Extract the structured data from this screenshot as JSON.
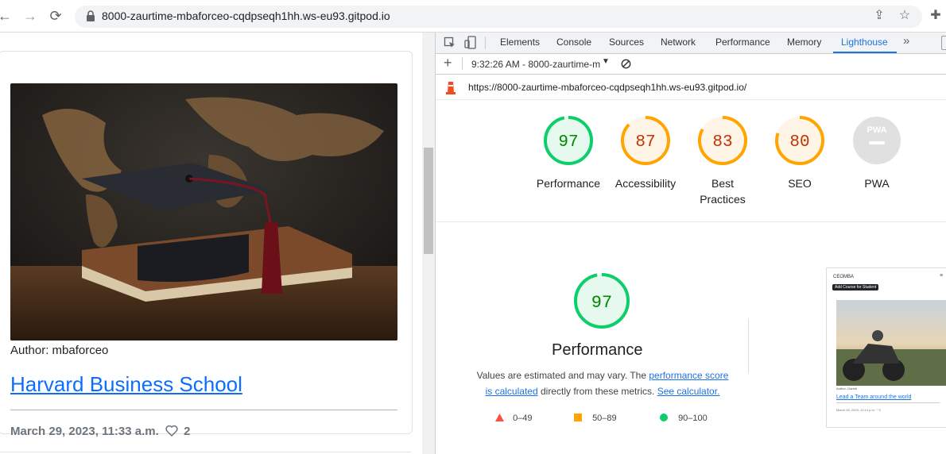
{
  "browser": {
    "url": "8000-zaurtime-mbaforceo-cqdpseqh1hh.ws-eu93.gitpod.io",
    "icons": [
      "back-icon",
      "forward-icon",
      "reload-icon",
      "lock-icon",
      "share-icon",
      "star-icon",
      "extensions-icon"
    ]
  },
  "post": {
    "author": "Author: mbaforceo",
    "title": "Harvard Business School",
    "date": "March 29, 2023, 11:33 a.m.",
    "likes": "2"
  },
  "devtools": {
    "tabs": [
      "Elements",
      "Console",
      "Sources",
      "Network",
      "Performance",
      "Memory",
      "Lighthouse"
    ],
    "active_tab": "Lighthouse",
    "more": "»",
    "report_time": "9:32:26 AM - 8000-zaurtime-m",
    "report_url": "https://8000-zaurtime-mbaforceo-cqdpseqh1hh.ws-eu93.gitpod.io/",
    "scores": [
      {
        "value": "97",
        "label": "Performance",
        "label2": "",
        "color": "#0cce6b",
        "text_color": "#008800",
        "bg": "#e6f9ee",
        "fraction": 0.97
      },
      {
        "value": "87",
        "label": "Accessibility",
        "label2": "",
        "color": "#ffa400",
        "text_color": "#c33300",
        "bg": "#fff5e6",
        "fraction": 0.87
      },
      {
        "value": "83",
        "label": "Best",
        "label2": "Practices",
        "color": "#ffa400",
        "text_color": "#c33300",
        "bg": "#fff5e6",
        "fraction": 0.83
      },
      {
        "value": "80",
        "label": "SEO",
        "label2": "",
        "color": "#ffa400",
        "text_color": "#c33300",
        "bg": "#fff5e6",
        "fraction": 0.8
      },
      {
        "value": "PWA",
        "label": "PWA",
        "label2": "",
        "color": "#e0e0e0",
        "text_color": "#ffffff",
        "bg": "#e0e0e0",
        "fraction": 0
      }
    ],
    "big_score": {
      "value": "97",
      "title": "Performance"
    },
    "description": {
      "text1": "Values are estimated and may vary. The ",
      "link1": "performance score",
      "link2": "is calculated",
      "text2": " directly from these metrics. ",
      "link3": "See calculator."
    },
    "legend": [
      {
        "range": "0–49",
        "color": "#ff4e42",
        "shape": "triangle"
      },
      {
        "range": "50–89",
        "color": "#ffa400",
        "shape": "square"
      },
      {
        "range": "90–100",
        "color": "#0cce6b",
        "shape": "circle"
      }
    ],
    "screenshot": {
      "brand": "CEOMBA",
      "button": "Add Course for Student",
      "author": "Author: Gareth",
      "title": "Lead a Team around the world",
      "date": "March 26, 2023, 12:14 p.m. ♡0"
    }
  }
}
